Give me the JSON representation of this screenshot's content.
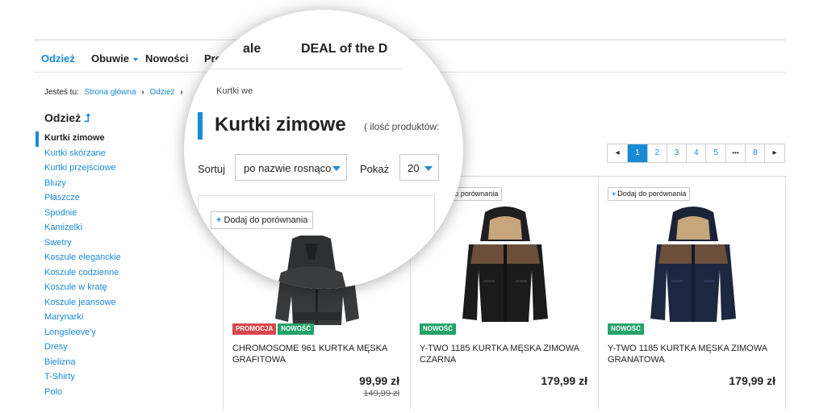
{
  "nav": {
    "items": [
      {
        "label": "Odzież",
        "active": true
      },
      {
        "label": "Obuwie",
        "dropdown": true
      },
      {
        "label": "Nowości"
      },
      {
        "label": "Premium"
      }
    ],
    "magnified": {
      "partial_item": "ale",
      "deal": "DEAL of the D"
    }
  },
  "breadcrumb": {
    "label": "Jesteś tu:",
    "items": [
      "Strona główna",
      "Odzież"
    ],
    "current": "Kurtki zimowe",
    "current_visible": "Kurtki we"
  },
  "sidebar": {
    "title": "Odzież",
    "items": [
      {
        "label": "Kurtki zimowe",
        "current": true
      },
      {
        "label": "Kurtki skórzane"
      },
      {
        "label": "Kurtki przejściowe"
      },
      {
        "label": "Bluzy"
      },
      {
        "label": "Płaszcze"
      },
      {
        "label": "Spodnie"
      },
      {
        "label": "Kamizelki"
      },
      {
        "label": "Swetry"
      },
      {
        "label": "Koszule eleganckie"
      },
      {
        "label": "Koszule codzienne"
      },
      {
        "label": "Koszule w kratę"
      },
      {
        "label": "Koszule jeansowe"
      },
      {
        "label": "Marynarki"
      },
      {
        "label": "Longsleeve'y"
      },
      {
        "label": "Dresy"
      },
      {
        "label": "Bielizna"
      },
      {
        "label": "T-Shirty"
      },
      {
        "label": "Polo"
      }
    ]
  },
  "page": {
    "title": "Kurtki zimowe",
    "count_label": "( ilość produktów:",
    "sort_label": "Sortuj",
    "sort_value": "po nazwie rosnąco",
    "show_label": "Pokaż",
    "show_value": "20"
  },
  "pagination": {
    "prev": "◂",
    "pages": [
      "1",
      "2",
      "3",
      "4",
      "5",
      "•••",
      "8"
    ],
    "current": "1",
    "next": "▸"
  },
  "products": [
    {
      "compare": "Dodaj do porównania",
      "badges": [
        "PROMOCJA",
        "NOWOŚĆ"
      ],
      "name": "CHROMOSOME 961 KURTKA MĘSKA GRAFITOWA",
      "price": "99,99 zł",
      "old_price": "149,99 zł",
      "color": "#3a3b3d"
    },
    {
      "compare": "Dodaj do porównania",
      "badges": [
        "NOWOŚĆ"
      ],
      "name": "Y-TWO 1185 KURTKA MĘSKA ZIMOWA CZARNA",
      "price": "179,99 zł",
      "color": "#1b1b1c"
    },
    {
      "compare": "Dodaj do porównania",
      "badges": [
        "NOWOŚĆ"
      ],
      "name": "Y-TWO 1185 KURTKA MĘSKA ZIMOWA GRANATOWA",
      "price": "179,99 zł",
      "color": "#1d2740"
    }
  ],
  "colors": {
    "accent": "#1a8ad6",
    "promo": "#d9474f",
    "new": "#24a46a",
    "fur": "#c7a67c",
    "yoke": "#6b4f3a"
  },
  "icons": [
    "chevron-down-icon",
    "arrow-up-icon",
    "chevron-right-icon",
    "plus-icon",
    "chevron-left-icon",
    "ellipsis-icon"
  ]
}
